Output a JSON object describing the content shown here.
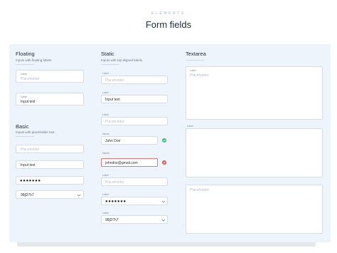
{
  "header": {
    "eyebrow": "ELEMENTS",
    "title": "Form fields"
  },
  "sections": {
    "floating": {
      "title": "Floating",
      "desc": "Inputs with floating labels.",
      "fields": [
        {
          "label": "Label",
          "placeholder": "Placeholder"
        },
        {
          "label": "Label",
          "value": "Input text"
        }
      ]
    },
    "basic": {
      "title": "Basic",
      "desc": "Inputs with placeholder text.",
      "fields": [
        {
          "placeholder": "Placeholder"
        },
        {
          "value": "Input text"
        },
        {
          "value": "●●●●●●●"
        },
        {
          "value": "98jD7h7"
        }
      ]
    },
    "static": {
      "title": "Static",
      "desc": "Inputs with top-aligned labels.",
      "fields": [
        {
          "label": "Label",
          "placeholder": "Placeholder"
        },
        {
          "label": "Label",
          "value": "Input text"
        },
        {
          "label": "Label",
          "placeholder": "Placeholder"
        },
        {
          "label": "Name",
          "value": "John Doe"
        },
        {
          "label": "Name",
          "value": "johndoe@gmail.com"
        },
        {
          "label": "Label",
          "placeholder": "Placeholder"
        },
        {
          "label": "Label",
          "value": "●●●●●●●"
        },
        {
          "label": "Label",
          "value": "98jD7h7"
        }
      ]
    },
    "textarea": {
      "title": "Textarea",
      "fields": [
        {
          "label": "Label",
          "placeholder": "Placeholder"
        },
        {
          "label": "Label"
        },
        {
          "placeholder": "Placeholder"
        }
      ]
    }
  },
  "colors": {
    "panel": "#eef4fc",
    "success": "#35c07c",
    "error": "#e9524a",
    "accent_line": "#e8746f"
  }
}
